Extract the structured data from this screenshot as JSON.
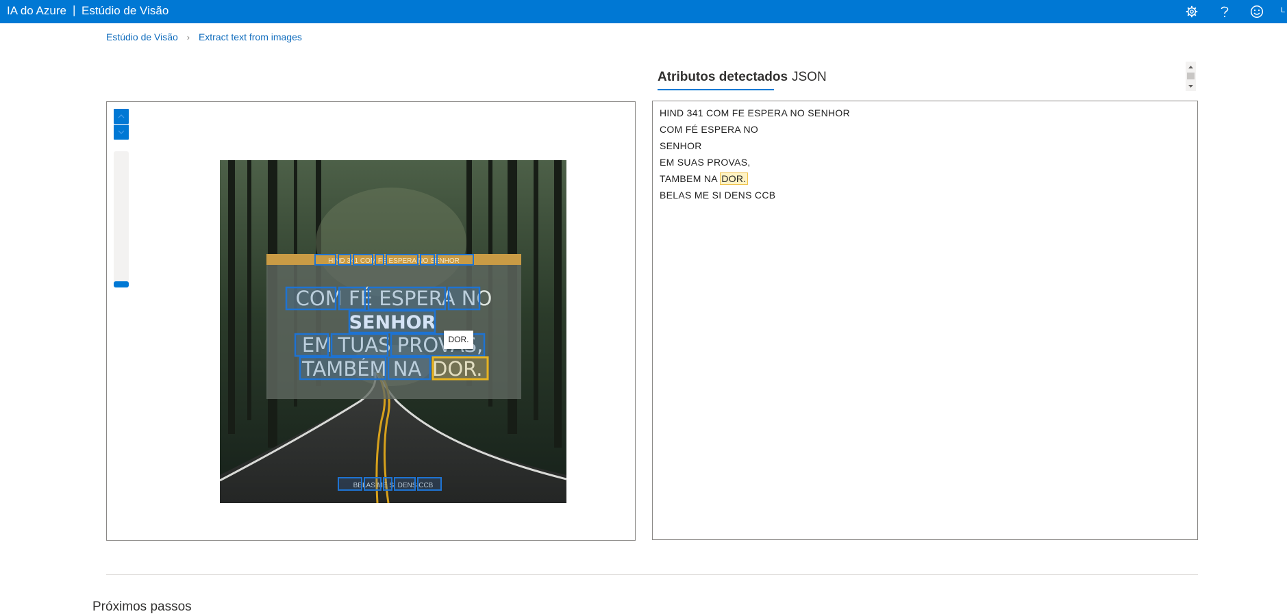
{
  "header": {
    "brand": "IA do Azure",
    "separator": "|",
    "product": "Estúdio de Visão",
    "icons": [
      "gear-icon",
      "help-icon",
      "feedback-smiley-icon"
    ],
    "avatar_initial": "L",
    "colors": {
      "bar": "#0078d4",
      "text": "#ffffff"
    }
  },
  "breadcrumb": {
    "root": "Estúdio de Visão",
    "separator": "›",
    "current": "Extract text from images"
  },
  "tabs": [
    {
      "label": "Atributos detectados",
      "active": true
    },
    {
      "label": "JSON",
      "active": false
    }
  ],
  "image_overlay": {
    "line1": "HIND 341 COM FE ESPERA NO SENHOR",
    "line2": "COM FÉ ESPERA NO",
    "line3": "SENHOR",
    "line4": "EM TUAS PROVAS,",
    "line5_prefix": "TAMBÉM NA",
    "line5_highlight": "DOR.",
    "bottom": "BELAS ME SI DENS CCB",
    "tooltip": "DOR."
  },
  "ocr_lines": [
    {
      "text": "HIND 341 COM FE ESPERA NO SENHOR"
    },
    {
      "text": "COM FÉ ESPERA NO"
    },
    {
      "text": "SENHOR"
    },
    {
      "text": "EM SUAS PROVAS,"
    },
    {
      "text": "TAMBEM NA",
      "highlight": "DOR."
    },
    {
      "text": "BELAS ME SI DENS CCB"
    }
  ],
  "section": {
    "next_steps": "Próximos passos"
  },
  "colors": {
    "accent": "#0078d4",
    "highlight": "#f0c24b"
  }
}
